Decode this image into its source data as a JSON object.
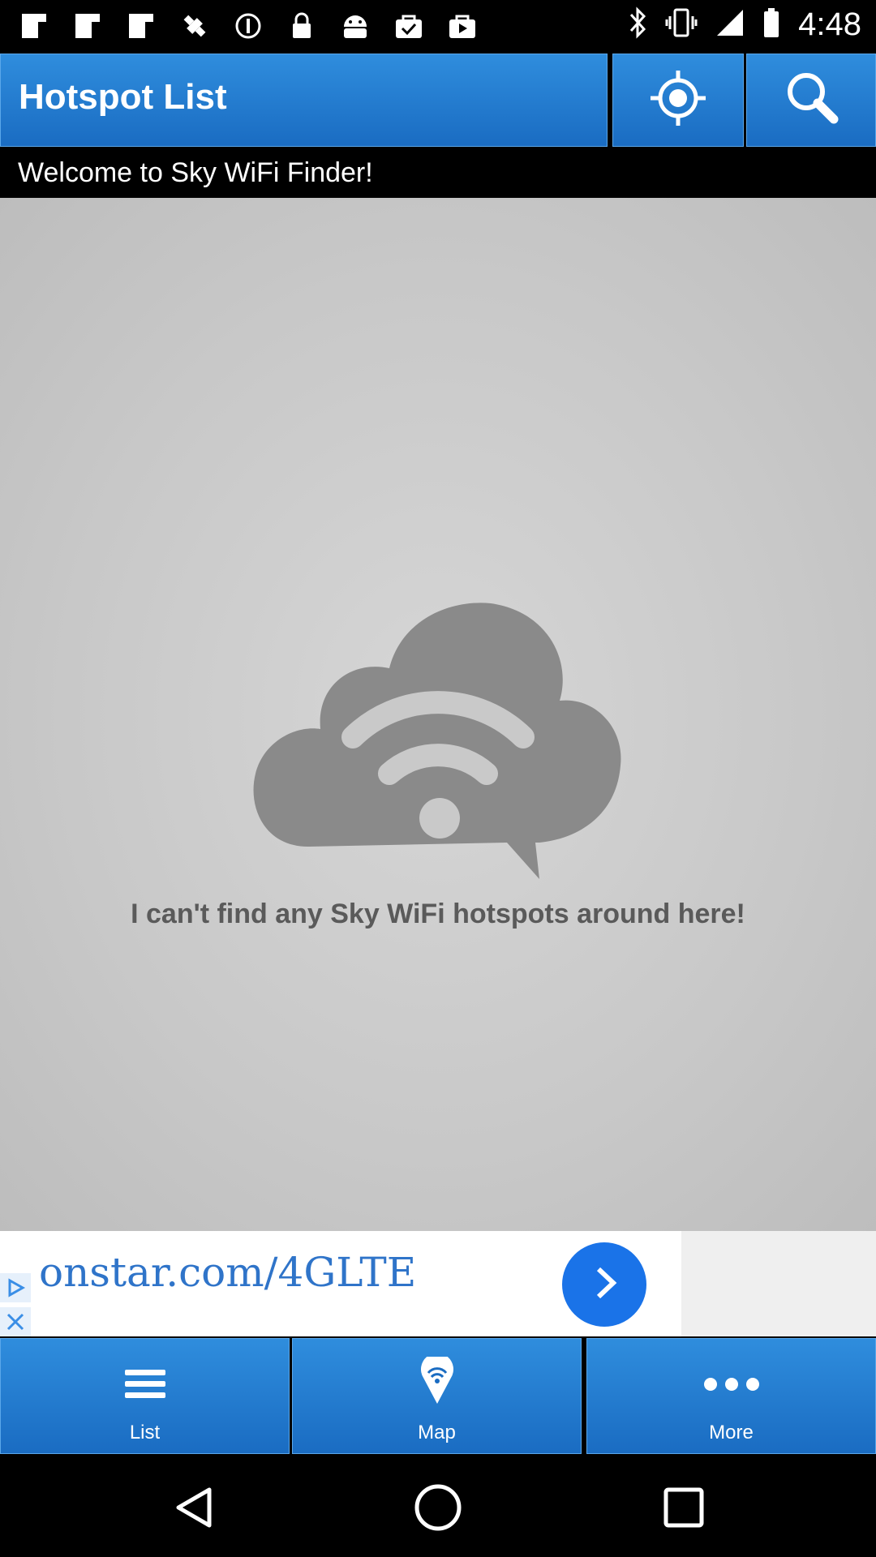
{
  "status_bar": {
    "time": "4:48",
    "left_icons": [
      "flipboard-icon",
      "flipboard-icon",
      "flipboard-icon",
      "fake-gps-icon",
      "circle-info-icon",
      "lock-icon",
      "android-icon",
      "checkbox-bag-icon",
      "play-bag-icon"
    ],
    "right_icons": [
      "bluetooth-icon",
      "vibrate-icon",
      "signal-icon",
      "battery-icon"
    ]
  },
  "header": {
    "title": "Hotspot List",
    "locate_icon": "crosshair-icon",
    "search_icon": "search-icon"
  },
  "welcome_text": "Welcome to Sky WiFi Finder!",
  "empty_state": {
    "icon": "cloud-wifi-icon",
    "message": "I can't find any Sky WiFi hotspots around here!"
  },
  "ad": {
    "text": "onstar.com/4GLTE",
    "icons": [
      "ad-play-icon",
      "ad-close-icon",
      "chevron-right-icon"
    ]
  },
  "tabs": [
    {
      "label": "List",
      "icon": "menu-icon"
    },
    {
      "label": "Map",
      "icon": "map-pin-wifi-icon"
    },
    {
      "label": "More",
      "icon": "more-dots-icon"
    }
  ],
  "nav": [
    "back-icon",
    "home-icon",
    "recents-icon"
  ],
  "colors": {
    "accent_blue": "#1a6cc2",
    "content_gray": "#c8c8c8",
    "ad_blue": "#1a73e8"
  }
}
